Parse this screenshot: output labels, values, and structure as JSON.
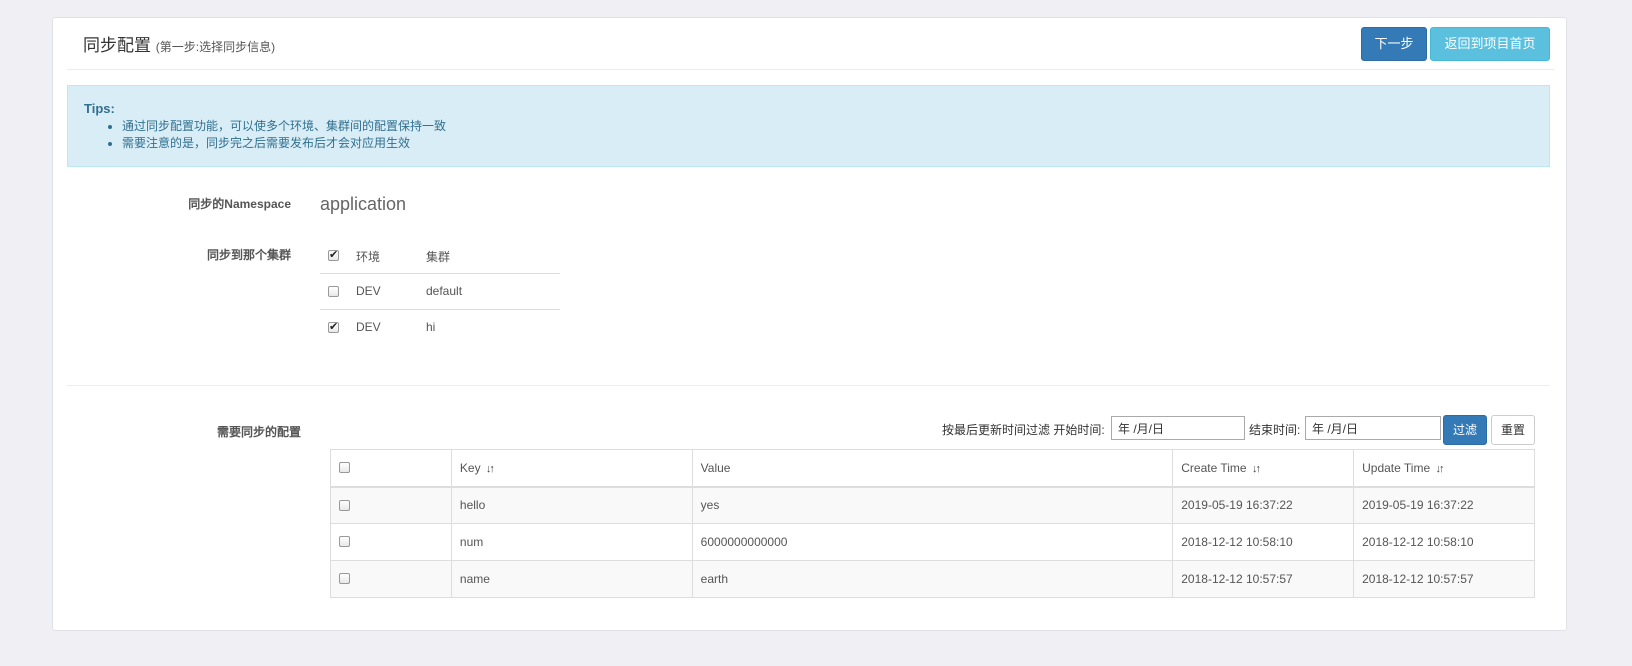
{
  "header": {
    "title": "同步配置",
    "subtitle": "(第一步:选择同步信息)",
    "next_label": "下一步",
    "return_label": "返回到项目首页"
  },
  "tips": {
    "title": "Tips:",
    "items": [
      "通过同步配置功能，可以使多个环境、集群间的配置保持一致",
      "需要注意的是，同步完之后需要发布后才会对应用生效"
    ]
  },
  "namespace": {
    "label": "同步的Namespace",
    "value": "application"
  },
  "clusters": {
    "label": "同步到那个集群",
    "header": {
      "env": "环境",
      "cluster": "集群",
      "checked": true
    },
    "rows": [
      {
        "env": "DEV",
        "cluster": "default",
        "checked": false
      },
      {
        "env": "DEV",
        "cluster": "hi",
        "checked": true
      }
    ]
  },
  "configs": {
    "label": "需要同步的配置",
    "filter": {
      "prefix": "按最后更新时间过滤 开始时间:",
      "start_placeholder": "年 /月/日",
      "end_label": "结束时间:",
      "end_placeholder": "年 /月/日",
      "filter_label": "过滤",
      "reset_label": "重置"
    },
    "columns": {
      "key": "Key",
      "value": "Value",
      "create_time": "Create Time",
      "update_time": "Update Time"
    },
    "rows": [
      {
        "key": "hello",
        "value": "yes",
        "create_time": "2019-05-19 16:37:22",
        "update_time": "2019-05-19 16:37:22"
      },
      {
        "key": "num",
        "value": "6000000000000",
        "create_time": "2018-12-12 10:58:10",
        "update_time": "2018-12-12 10:58:10"
      },
      {
        "key": "name",
        "value": "earth",
        "create_time": "2018-12-12 10:57:57",
        "update_time": "2018-12-12 10:57:57"
      }
    ]
  },
  "colors": {
    "primary": "#337ab7",
    "info": "#5bc0de",
    "tips_bg": "#d9edf7",
    "tips_text": "#31708f"
  }
}
